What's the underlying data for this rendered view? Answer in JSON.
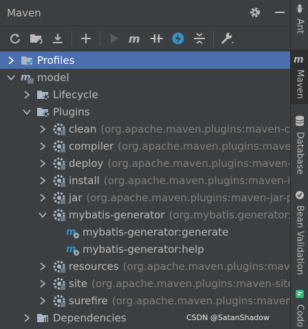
{
  "panel": {
    "title": "Maven"
  },
  "toolbar": {
    "buttons": [
      "reload-icon",
      "add-folder-icon",
      "download-icon",
      "plus-icon",
      "run-icon",
      "maven-goal-icon",
      "toggle-offline-icon",
      "skip-tests-icon",
      "collapse-all-icon",
      "settings-wrench-icon"
    ]
  },
  "tree": {
    "profiles": "Profiles",
    "model": "model",
    "lifecycle": "Lifecycle",
    "plugins": "Plugins",
    "plugin_items": [
      {
        "name": "clean",
        "coord": "(org.apache.maven.plugins:maven-clea"
      },
      {
        "name": "compiler",
        "coord": "(org.apache.maven.plugins:maven-"
      },
      {
        "name": "deploy",
        "coord": "(org.apache.maven.plugins:maven-de"
      },
      {
        "name": "install",
        "coord": "(org.apache.maven.plugins:maven-ins"
      },
      {
        "name": "jar",
        "coord": "(org.apache.maven.plugins:maven-jar-plu"
      },
      {
        "name": "mybatis-generator",
        "coord": "(org.mybatis.generator:m"
      },
      {
        "name": "resources",
        "coord": "(org.apache.maven.plugins:maven"
      },
      {
        "name": "site",
        "coord": "(org.apache.maven.plugins:maven-site-p"
      },
      {
        "name": "surefire",
        "coord": "(org.apache.maven.plugins:maven-s"
      }
    ],
    "goals": [
      "mybatis-generator:generate",
      "mybatis-generator:help"
    ],
    "dependencies": "Dependencies"
  },
  "sidebar": {
    "tabs": [
      "Ant",
      "Maven",
      "Database",
      "Bean Validation",
      "Codo"
    ]
  },
  "watermark": "CSDN @SatanShadow",
  "colors": {
    "background": "#3c3f41",
    "selection": "#4b6eaf",
    "text": "#bbbbbb",
    "muted": "#808080",
    "accent_blue": "#3592c4"
  }
}
